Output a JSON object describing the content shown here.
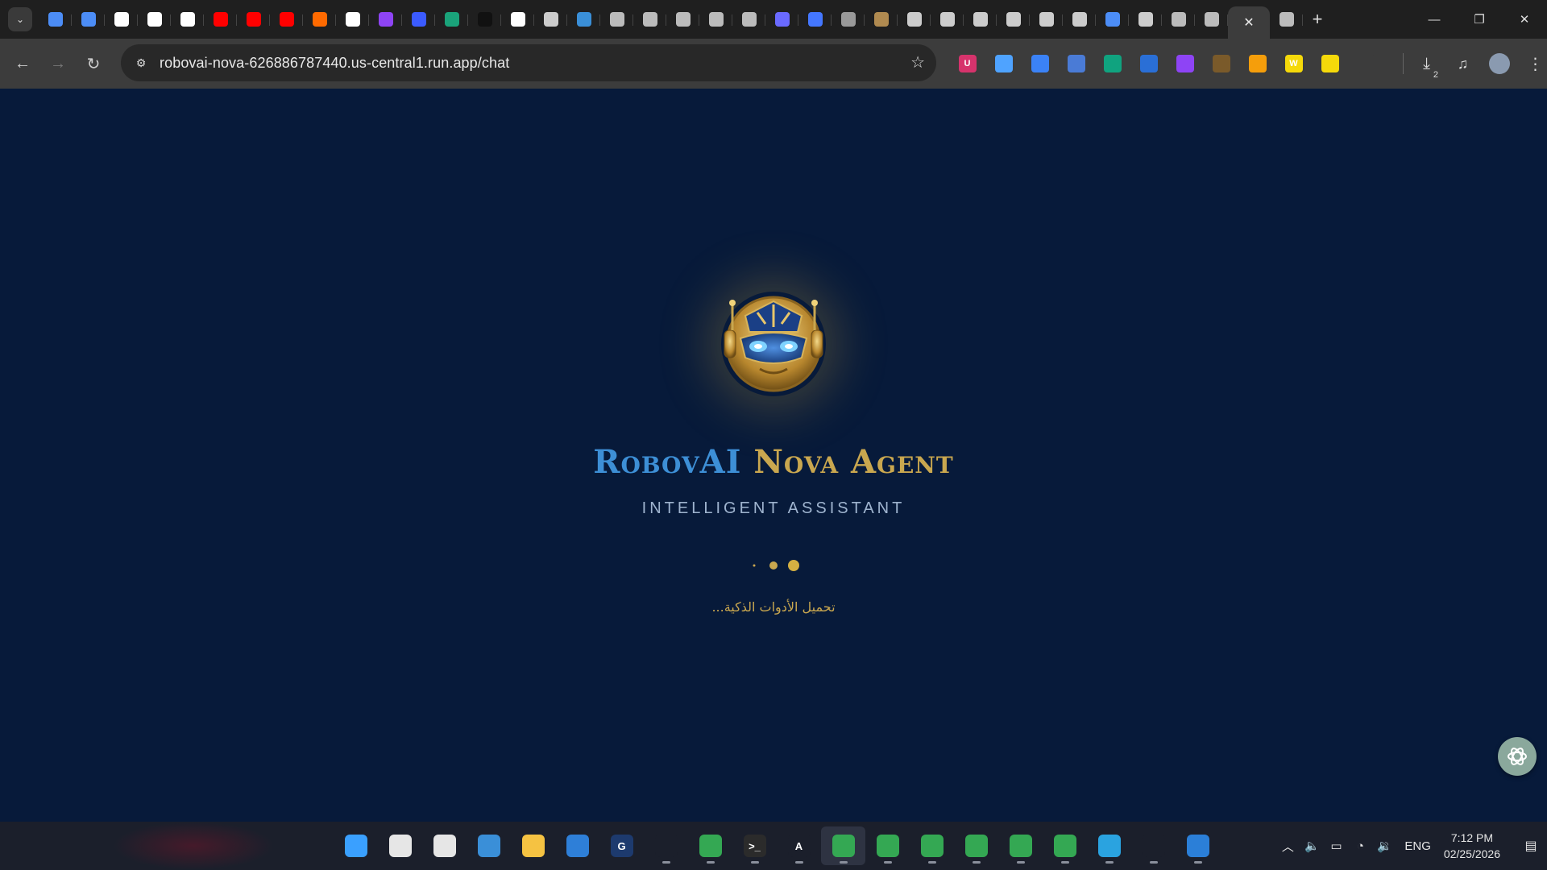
{
  "browser": {
    "tabs": [
      {
        "icon": "gemini-icon",
        "color": "#4c8df6"
      },
      {
        "icon": "gemini-icon",
        "color": "#4c8df6"
      },
      {
        "icon": "chatgpt-icon",
        "color": "#ffffff"
      },
      {
        "icon": "chatgpt-icon",
        "color": "#ffffff"
      },
      {
        "icon": "doc-icon",
        "color": "#ffffff"
      },
      {
        "icon": "youtube-icon",
        "color": "#ff0000"
      },
      {
        "icon": "youtube-icon",
        "color": "#ff0000"
      },
      {
        "icon": "youtube-icon",
        "color": "#ff0000"
      },
      {
        "icon": "app-icon",
        "color": "#ff6a00"
      },
      {
        "icon": "google-icon",
        "color": "#ffffff"
      },
      {
        "icon": "p-icon",
        "color": "#8e44f5"
      },
      {
        "icon": "p-icon",
        "color": "#3b5bff"
      },
      {
        "icon": "r-icon",
        "color": "#1aa37a"
      },
      {
        "icon": "smile-icon",
        "color": "#111111"
      },
      {
        "icon": "pause-icon",
        "color": "#ffffff"
      },
      {
        "icon": "sound-icon",
        "color": "#cccccc"
      },
      {
        "icon": "arrow-icon",
        "color": "#3a8fd8"
      },
      {
        "icon": "globe-icon",
        "color": "#bbbbbb"
      },
      {
        "icon": "globe-icon",
        "color": "#bbbbbb"
      },
      {
        "icon": "chrome-icon",
        "color": "#bbbbbb"
      },
      {
        "icon": "app-icon",
        "color": "#bbbbbb"
      },
      {
        "icon": "globe-icon",
        "color": "#bbbbbb"
      },
      {
        "icon": "app-icon",
        "color": "#6a6aff"
      },
      {
        "icon": "app-icon",
        "color": "#4477ff"
      },
      {
        "icon": "app-icon",
        "color": "#999999"
      },
      {
        "icon": "app-icon",
        "color": "#b08a50"
      },
      {
        "icon": "external-icon",
        "color": "#cccccc"
      },
      {
        "icon": "external-icon",
        "color": "#cccccc"
      },
      {
        "icon": "external-icon",
        "color": "#cccccc"
      },
      {
        "icon": "external-icon",
        "color": "#cccccc"
      },
      {
        "icon": "external-icon",
        "color": "#cccccc"
      },
      {
        "icon": "external-icon",
        "color": "#cccccc"
      },
      {
        "icon": "gemini-icon",
        "color": "#4c8df6"
      },
      {
        "icon": "external-icon",
        "color": "#cccccc"
      },
      {
        "icon": "globe-icon",
        "color": "#bbbbbb"
      },
      {
        "icon": "chrome-icon",
        "color": "#bbbbbb"
      }
    ],
    "active_tab_close": "✕",
    "after_tabs": [
      {
        "icon": "globe-icon",
        "color": "#bbbbbb"
      }
    ],
    "url": "robovai-nova-626886787440.us-central1.run.app/chat",
    "extensions": [
      {
        "icon": "shield-icon",
        "color": "#d6336c",
        "label": "U"
      },
      {
        "icon": "circle-icon",
        "color": "#4fa3ff",
        "label": ""
      },
      {
        "icon": "camera-icon",
        "color": "#3b82f6",
        "label": ""
      },
      {
        "icon": "cube-icon",
        "color": "#4a7bd6",
        "label": ""
      },
      {
        "icon": "chatgpt-icon",
        "color": "#10a37f",
        "label": ""
      },
      {
        "icon": "pen-icon",
        "color": "#2a6fd6",
        "label": ""
      },
      {
        "icon": "app-icon",
        "color": "#8e44f5",
        "label": ""
      },
      {
        "icon": "app-icon",
        "color": "#7a5a2a",
        "label": ""
      },
      {
        "icon": "face-icon",
        "color": "#f59e0b",
        "label": ""
      },
      {
        "icon": "w-icon",
        "color": "#f5d90a",
        "label": "W"
      },
      {
        "icon": "download-icon",
        "color": "#f5d90a",
        "label": ""
      },
      {
        "icon": "puzzle-icon",
        "color": "#3c3c3c",
        "label": ""
      }
    ],
    "downloads_count": "2"
  },
  "app": {
    "title_part1": "RobovAI",
    "title_part2": "Nova Agent",
    "subtitle": "INTELLIGENT ASSISTANT",
    "loading_text": "تحميل الأدوات الذكية...",
    "accent_gold": "#c9a74f",
    "accent_blue": "#3d8fd6",
    "background": "#071a3a"
  },
  "taskbar": {
    "apps": [
      {
        "icon": "windows-start-icon",
        "color": "#3aa0ff",
        "label": ""
      },
      {
        "icon": "search-icon",
        "color": "#e6e6e6",
        "label": ""
      },
      {
        "icon": "task-view-icon",
        "color": "#e6e6e6",
        "label": ""
      },
      {
        "icon": "widgets-icon",
        "color": "#3a8fd8",
        "label": ""
      },
      {
        "icon": "file-explorer-icon",
        "color": "#f5c242",
        "label": ""
      },
      {
        "icon": "store-icon",
        "color": "#2e7fd8",
        "label": ""
      },
      {
        "icon": "g-app-icon",
        "color": "#1d3a6e",
        "label": "G"
      },
      {
        "icon": "blank-icon",
        "color": "#1b1f2b",
        "label": ""
      },
      {
        "icon": "chrome-icon",
        "color": "#34a853",
        "label": ""
      },
      {
        "icon": "terminal-icon",
        "color": "#2b2b2b",
        "label": ">_"
      },
      {
        "icon": "a-app-icon",
        "color": "#1b1f2b",
        "label": "A"
      },
      {
        "icon": "chrome-icon",
        "color": "#34a853",
        "label": ""
      },
      {
        "icon": "chrome-icon",
        "color": "#34a853",
        "label": ""
      },
      {
        "icon": "chrome-icon",
        "color": "#34a853",
        "label": ""
      },
      {
        "icon": "chrome-icon",
        "color": "#34a853",
        "label": ""
      },
      {
        "icon": "chrome-icon",
        "color": "#34a853",
        "label": ""
      },
      {
        "icon": "chrome-icon",
        "color": "#34a853",
        "label": ""
      },
      {
        "icon": "telegram-icon",
        "color": "#2aa3e0",
        "label": ""
      },
      {
        "icon": "media-player-icon",
        "color": "#1b1f2b",
        "label": ""
      },
      {
        "icon": "video-editor-icon",
        "color": "#2b7fd8",
        "label": ""
      }
    ],
    "language": "ENG",
    "time": "7:12 PM",
    "date": "02/25/2026"
  }
}
